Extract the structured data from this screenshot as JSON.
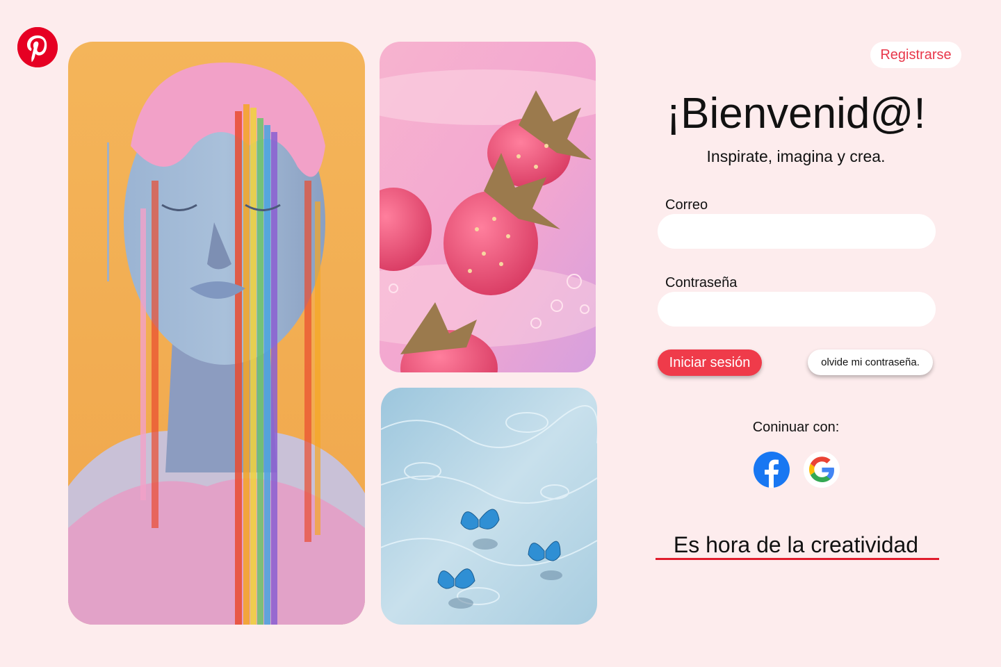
{
  "brand": {
    "logo_icon": "pinterest-logo-icon",
    "color": "#e60023"
  },
  "header": {
    "register_label": "Registrarse"
  },
  "login": {
    "title": "¡Bienvenid@!",
    "subtitle": "Inspirate, imagina y crea.",
    "email_label": "Correo",
    "email_value": "",
    "password_label": "Contraseña",
    "password_value": "",
    "login_button": "Iniciar sesión",
    "forgot_button": "olvide mi contraseña.",
    "continue_with": "Coninuar con:",
    "social": [
      {
        "icon": "facebook-icon",
        "color": "#1877f2"
      },
      {
        "icon": "google-icon"
      }
    ],
    "tagline": "Es hora de la creatividad"
  },
  "gallery": [
    {
      "icon": "melting-face-image"
    },
    {
      "icon": "strawberries-image"
    },
    {
      "icon": "butterflies-water-image"
    }
  ],
  "colors": {
    "background": "#fdeced",
    "accent": "#ef3b4a",
    "underline": "#e01c2c"
  }
}
